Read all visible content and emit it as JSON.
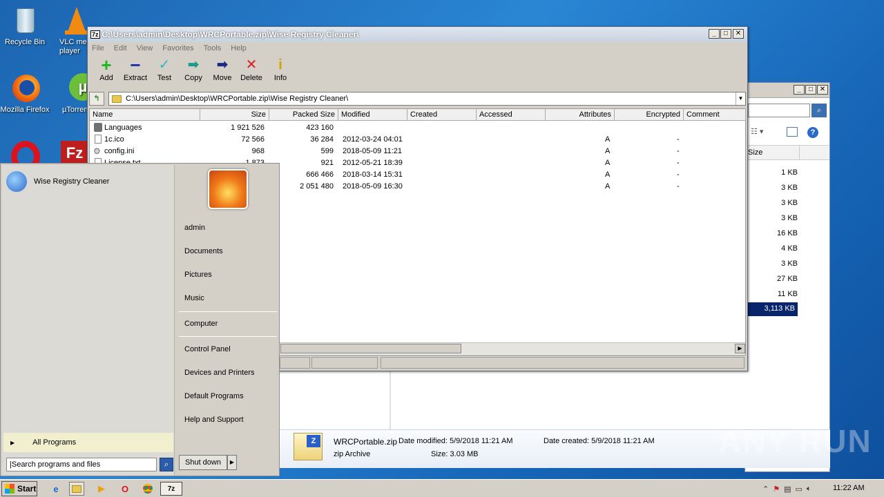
{
  "desktop": {
    "icons": [
      {
        "label": "Recycle Bin"
      },
      {
        "label": "VLC media player"
      },
      {
        "label": "Mozilla Firefox"
      },
      {
        "label": "µTorrent"
      }
    ]
  },
  "bg_window": {
    "size_header": "Size",
    "sizes": [
      "1 KB",
      "3 KB",
      "3 KB",
      "3 KB",
      "16 KB",
      "4 KB",
      "3 KB",
      "27 KB",
      "11 KB",
      "3,113 KB"
    ],
    "details": {
      "name": "WRCPortable.zip",
      "type": "zip Archive",
      "date_modified_label": "Date modified:",
      "date_modified": "5/9/2018 11:21 AM",
      "date_created_label": "Date created:",
      "date_created": "5/9/2018 11:21 AM",
      "size_label": "Size:",
      "size": "3.03 MB"
    }
  },
  "zip_window": {
    "title": "C:\\Users\\admin\\Desktop\\WRCPortable.zip\\Wise Registry Cleaner\\",
    "title_icon": "7z",
    "menu": [
      "File",
      "Edit",
      "View",
      "Favorites",
      "Tools",
      "Help"
    ],
    "toolbar": {
      "add": "Add",
      "extract": "Extract",
      "test": "Test",
      "copy": "Copy",
      "move": "Move",
      "delete": "Delete",
      "info": "Info"
    },
    "address": "C:\\Users\\admin\\Desktop\\WRCPortable.zip\\Wise Registry Cleaner\\",
    "columns": [
      "Name",
      "Size",
      "Packed Size",
      "Modified",
      "Created",
      "Accessed",
      "Attributes",
      "Encrypted",
      "Comment"
    ],
    "rows": [
      {
        "name": "Languages",
        "size": "1 921 526",
        "packed": "423 160",
        "modified": "",
        "attr": "",
        "enc": ""
      },
      {
        "name": "1c.ico",
        "size": "72 566",
        "packed": "36 284",
        "modified": "2012-03-24 04:01",
        "attr": "A",
        "enc": "-"
      },
      {
        "name": "config.ini",
        "size": "968",
        "packed": "599",
        "modified": "2018-05-09 11:21",
        "attr": "A",
        "enc": "-"
      },
      {
        "name": "License.txt",
        "size": "1 873",
        "packed": "921",
        "modified": "2012-05-21 18:39",
        "attr": "A",
        "enc": "-"
      },
      {
        "name": "",
        "size": "",
        "packed": "666 466",
        "modified": "2018-03-14 15:31",
        "attr": "A",
        "enc": "-"
      },
      {
        "name": "",
        "size": "",
        "packed": "2 051 480",
        "modified": "2018-05-09 16:30",
        "attr": "A",
        "enc": "-"
      }
    ]
  },
  "start_menu": {
    "pinned_program": "Wise Registry Cleaner",
    "right_items": [
      "admin",
      "Documents",
      "Pictures",
      "Music",
      "Computer",
      "Control Panel",
      "Devices and Printers",
      "Default Programs",
      "Help and Support"
    ],
    "all_programs": "All Programs",
    "search_placeholder": "Search programs and files",
    "shutdown": "Shut down"
  },
  "taskbar": {
    "start": "Start",
    "clock": "11:22 AM"
  },
  "watermark": "ANY RUN"
}
